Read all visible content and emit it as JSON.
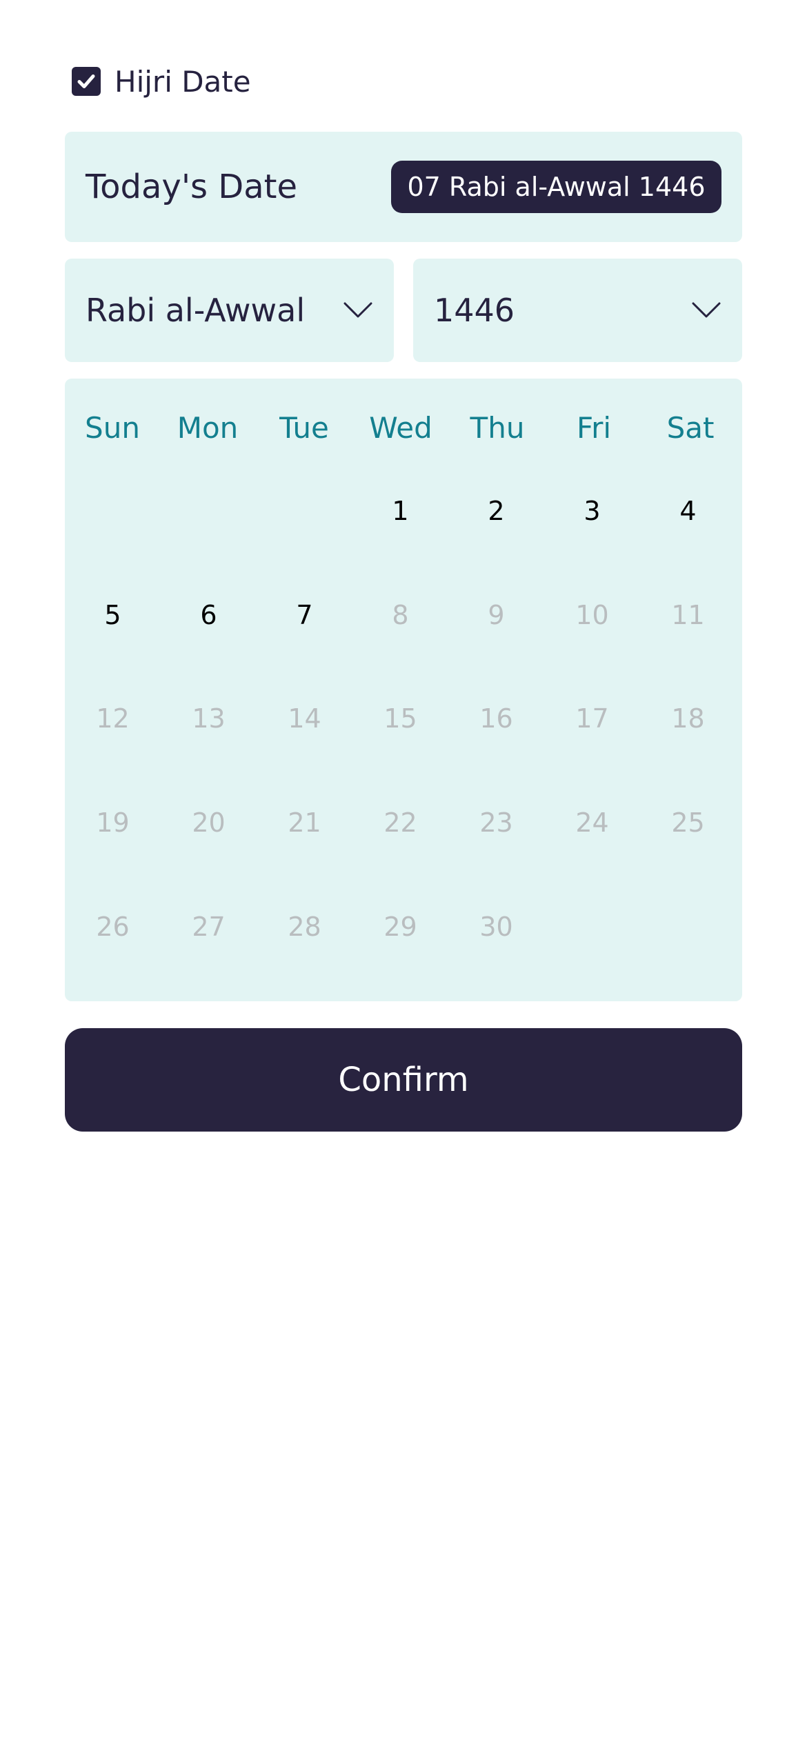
{
  "hijri_toggle": {
    "label": "Hijri Date",
    "checked": true
  },
  "today": {
    "label": "Today's Date",
    "value": "07 Rabi al-Awwal 1446"
  },
  "month_select": {
    "value": "Rabi al-Awwal",
    "icon": "chevron-down-icon"
  },
  "year_select": {
    "value": "1446",
    "icon": "chevron-down-icon"
  },
  "calendar": {
    "weekdays": [
      "Sun",
      "Mon",
      "Tue",
      "Wed",
      "Thu",
      "Fri",
      "Sat"
    ],
    "weeks": [
      [
        "",
        "",
        "",
        "1",
        "2",
        "3",
        "4"
      ],
      [
        "5",
        "6",
        "7",
        "8",
        "9",
        "10",
        "11"
      ],
      [
        "12",
        "13",
        "14",
        "15",
        "16",
        "17",
        "18"
      ],
      [
        "19",
        "20",
        "21",
        "22",
        "23",
        "24",
        "25"
      ],
      [
        "26",
        "27",
        "28",
        "29",
        "30",
        "",
        ""
      ]
    ],
    "last_selectable_day": 7
  },
  "confirm_label": "Confirm",
  "colors": {
    "primary_dark": "#26223f",
    "panel_bg": "#e2f4f3",
    "weekday_teal": "#137f8f",
    "disabled_day": "#b9bdbf"
  }
}
